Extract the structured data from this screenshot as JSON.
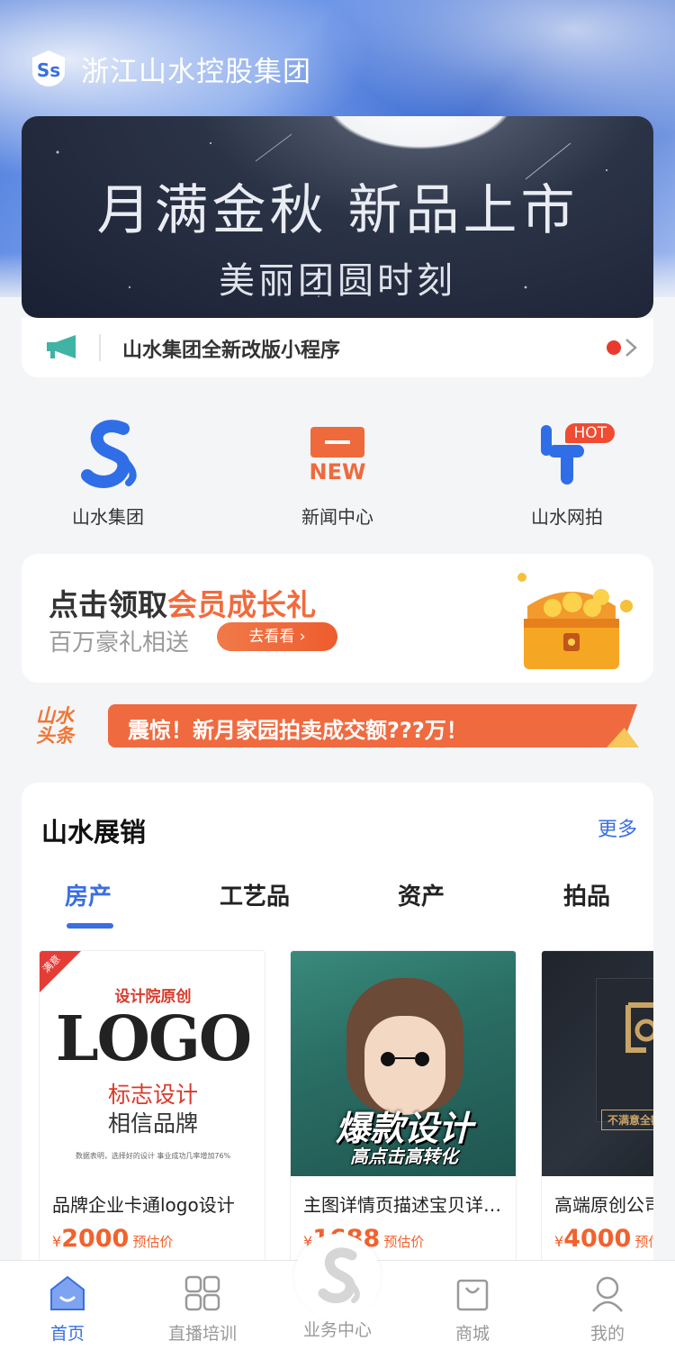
{
  "header": {
    "company_name": "浙江山水控股集团"
  },
  "banner": {
    "line1": "月满金秋 新品上市",
    "line2": "美丽团圆时刻"
  },
  "notice": {
    "text": "山水集团全新改版小程序"
  },
  "quick_links": [
    {
      "label": "山水集团",
      "icon": "shanshui-logo-icon"
    },
    {
      "label": "新闻中心",
      "icon": "new-badge-icon",
      "badge_text": "NEW"
    },
    {
      "label": "山水网拍",
      "icon": "auction-t-icon",
      "hot_label": "HOT"
    }
  ],
  "member": {
    "title_prefix": "点击领取",
    "title_highlight": "会员成长礼",
    "subtitle": "百万豪礼相送",
    "button": "去看看 ›"
  },
  "headline": {
    "tag_line1": "山水",
    "tag_line2": "头条",
    "text": "震惊！新月家园拍卖成交额???万！"
  },
  "showcase": {
    "title": "山水展销",
    "more": "更多",
    "tabs": [
      "房产",
      "工艺品",
      "资产",
      "拍品"
    ],
    "products": [
      {
        "name": "品牌企业卡通logo设计",
        "price_symbol": "¥",
        "price": "2000",
        "price_note": "预估价",
        "image": {
          "ribbon": "满意",
          "top": "设计院原创",
          "main": "LOGO",
          "line1": "标志设计",
          "line2": "相信品牌",
          "small": "数据表明，选择好的设计 事业成功几率增加76%"
        }
      },
      {
        "name": "主图详情页描述宝贝详情页设计",
        "price_symbol": "¥",
        "price": "1688",
        "price_note": "预估价",
        "image": {
          "headline": "爆款设计",
          "subline": "高点击高转化"
        }
      },
      {
        "name": "高端原创公司logo设计",
        "price_symbol": "¥",
        "price": "4000",
        "price_note": "预估价",
        "image": {
          "tag": "不满意全额退"
        }
      }
    ]
  },
  "tabbar": [
    {
      "label": "首页",
      "icon": "home-icon",
      "active": true
    },
    {
      "label": "直播培训",
      "icon": "grid-icon",
      "active": false
    },
    {
      "label": "业务中心",
      "icon": "shanshui-logo-icon",
      "active": false
    },
    {
      "label": "商城",
      "icon": "shopping-bag-icon",
      "active": false
    },
    {
      "label": "我的",
      "icon": "user-icon",
      "active": false
    }
  ],
  "colors": {
    "accent": "#3a6fe0",
    "orange": "#f06a40",
    "red_dot": "#e83a2e"
  }
}
